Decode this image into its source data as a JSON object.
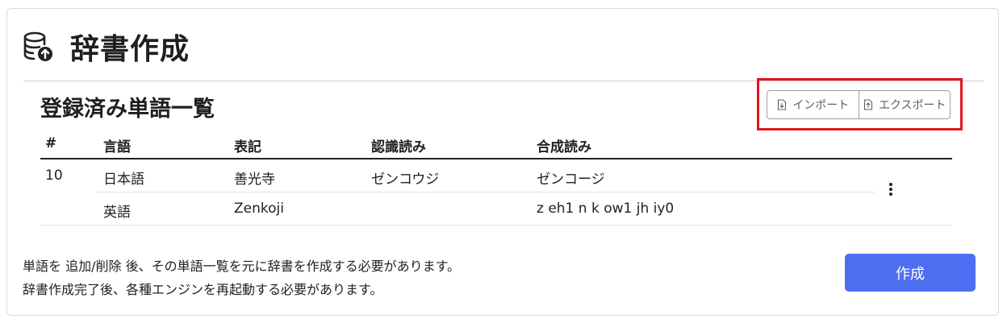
{
  "header": {
    "title": "辞書作成",
    "icon": "database-upload-icon"
  },
  "section": {
    "title": "登録済み単語一覧"
  },
  "actions": {
    "import_label": "インポート",
    "export_label": "エクスポート"
  },
  "table": {
    "columns": [
      "#",
      "言語",
      "表記",
      "認識読み",
      "合成読み"
    ],
    "rows": [
      {
        "num": "10",
        "lang": "日本語",
        "notation": "善光寺",
        "recognition": "ゼンコウジ",
        "synthesis": "ゼンコージ"
      },
      {
        "num": "",
        "lang": "英語",
        "notation": "Zenkoji",
        "recognition": "",
        "synthesis": "z eh1 n k ow1 jh iy0"
      }
    ]
  },
  "notes": [
    "単語を 追加/削除 後、その単語一覧を元に辞書を作成する必要があります。",
    "辞書作成完了後、各種エンジンを再起動する必要があります。"
  ],
  "create_button": {
    "label": "作成"
  },
  "colors": {
    "primary": "#4e6ef2",
    "highlight": "#e3131c",
    "border": "#d9d9d9"
  }
}
